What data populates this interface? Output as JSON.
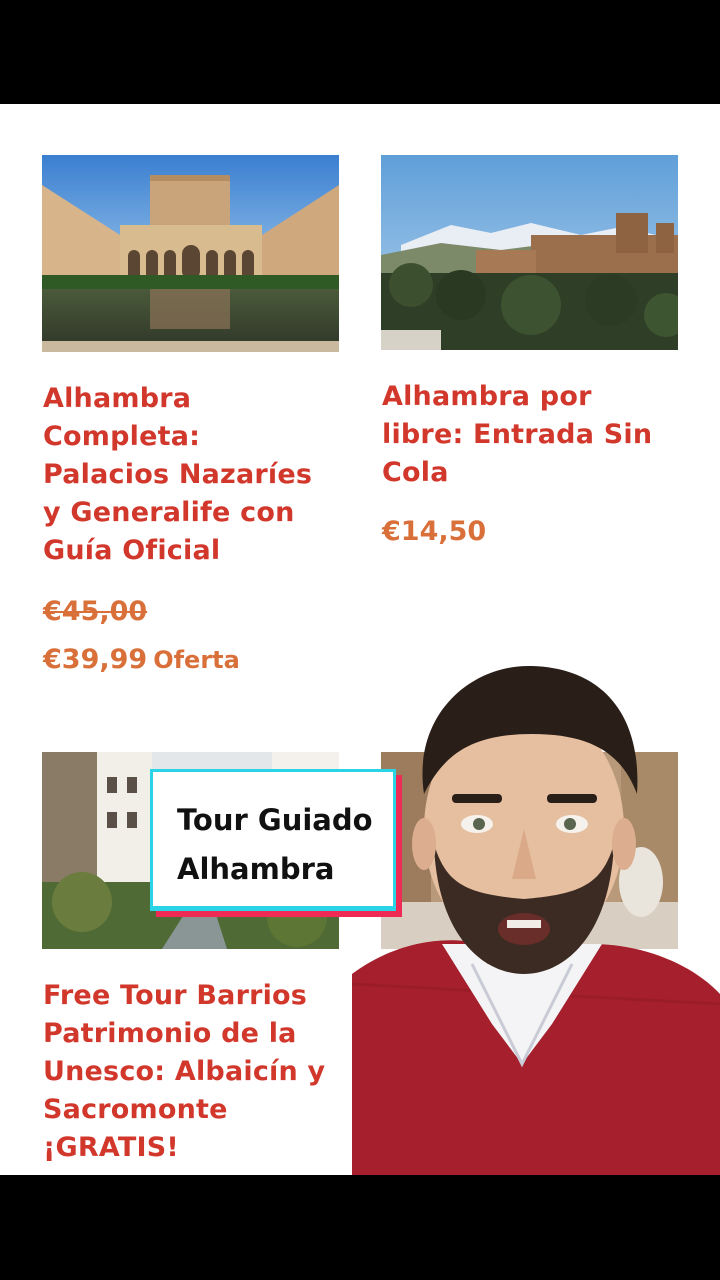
{
  "products": [
    {
      "title_lines": [
        "Alhambra",
        "Completa:",
        "Palacios Nazaríes",
        "y Generalife con",
        "Guía Oficial"
      ],
      "old_price": "€45,00",
      "price": "€39,99",
      "badge": "Oferta"
    },
    {
      "title_lines": [
        "Alhambra por",
        "libre: Entrada Sin",
        "Cola"
      ],
      "price": "€14,50"
    },
    {
      "title_lines": [
        "Free Tour Barrios",
        "Patrimonio de la",
        "Unesco: Albaicín y",
        "Sacromonte",
        "¡GRATIS!"
      ]
    }
  ],
  "overlay": {
    "line1": "Tour Guiado",
    "line2": "Alhambra"
  },
  "colors": {
    "title": "#d2372b",
    "price": "#d9703a",
    "tag_cyan": "#2bd3e6",
    "tag_red": "#ee2a55"
  }
}
